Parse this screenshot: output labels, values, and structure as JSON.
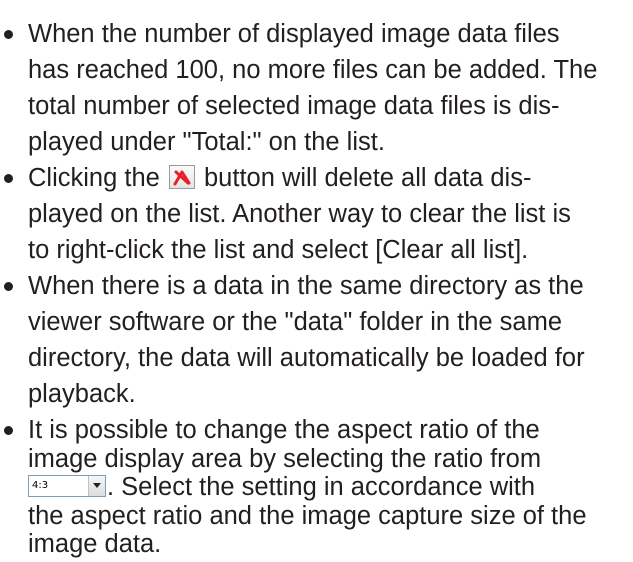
{
  "bullets": [
    {
      "lines": [
        "When the number of displayed image data files",
        "has reached 100, no more files can be added. The",
        "total number of selected image data files is dis-",
        "played under \"Total:\" on the list."
      ]
    },
    {
      "line1_before": "Clicking the",
      "line1_after": "button will delete all data dis-",
      "lines_rest": [
        "played on the list. Another way to clear the list is",
        "to right-click the list and select [Clear all list]."
      ],
      "icon": "delete-x-icon"
    },
    {
      "lines": [
        "When there is a data in the same directory as the",
        "viewer software or the \"data\" folder in the same",
        "directory, the data will automatically be loaded for",
        "playback."
      ]
    },
    {
      "line1": "It is possible to change the aspect ratio of the",
      "line2": "image display area by selecting the ratio from",
      "select_value": "4:3",
      "line3_after": ". Select the setting in accordance with",
      "lines_rest": [
        "the aspect ratio and the image capture size of the",
        "image data."
      ],
      "icon": "dropdown-arrow-icon"
    }
  ],
  "colors": {
    "text": "#231f20",
    "delete_icon": "#e8202a"
  }
}
